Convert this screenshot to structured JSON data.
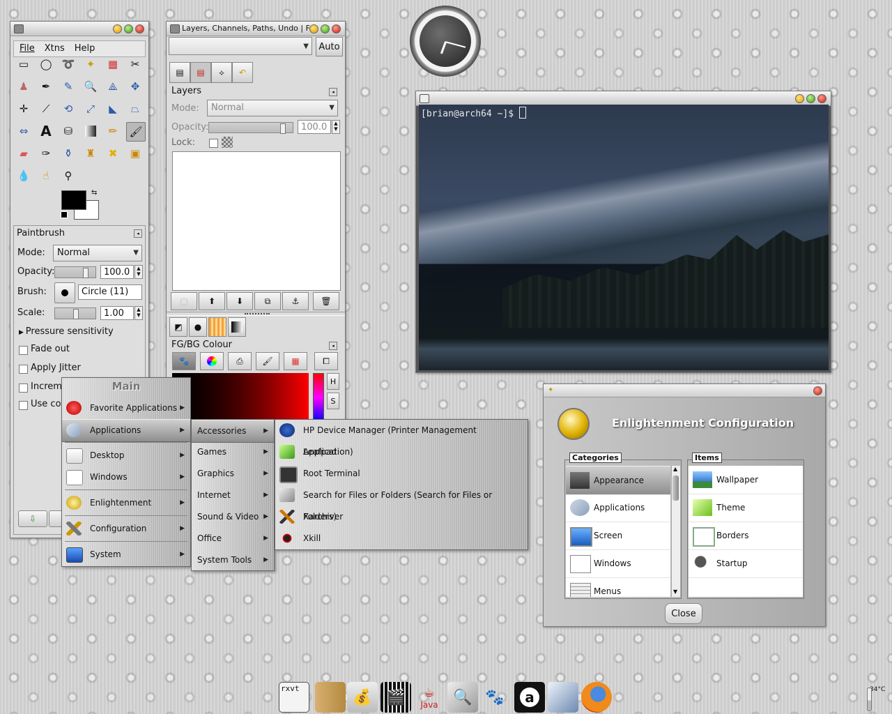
{
  "toolbox": {
    "menu": [
      "File",
      "Xtns",
      "Help"
    ],
    "panel_title": "Paintbrush",
    "mode_label": "Mode:",
    "mode_value": "Normal",
    "opacity_label": "Opacity:",
    "opacity_value": "100.0",
    "brush_label": "Brush:",
    "brush_value": "Circle (11)",
    "scale_label": "Scale:",
    "scale_value": "1.00",
    "pressure": "Pressure sensitivity",
    "fade_out": "Fade out",
    "apply_jitter": "Apply Jitter",
    "incremental": "Increme",
    "use_color": "Use co"
  },
  "layers_window": {
    "title": "Layers, Channels, Paths, Undo | F...",
    "auto_button": "Auto",
    "section_title": "Layers",
    "mode_label": "Mode:",
    "mode_value": "Normal",
    "opacity_label": "Opacity:",
    "opacity_value": "100.0",
    "lock_label": "Lock:",
    "fgbg_title": "FG/BG Colour",
    "hue_letter": "H",
    "sat_letter": "S"
  },
  "terminal": {
    "prompt": "[brian@arch64 ~]$ "
  },
  "main_menu": {
    "title": "Main",
    "items": [
      "Favorite Applications",
      "Applications",
      "Desktop",
      "Windows",
      "Enlightenment",
      "Configuration",
      "System"
    ]
  },
  "apps_menu": {
    "items": [
      "Accessories",
      "Games",
      "Graphics",
      "Internet",
      "Sound & Video",
      "Office",
      "System Tools"
    ]
  },
  "accessories_menu": {
    "items": [
      "HP Device Manager (Printer Management Application)",
      "Leafpad",
      "Root Terminal",
      "Search for Files or Folders (Search for Files or Folders)",
      "Xarchiver",
      "Xkill"
    ]
  },
  "config_dialog": {
    "title": "Enlightenment Configuration",
    "categories_label": "Categories",
    "items_label": "Items",
    "categories": [
      "Appearance",
      "Applications",
      "Screen",
      "Windows",
      "Menus"
    ],
    "items": [
      "Wallpaper",
      "Theme",
      "Borders",
      "Startup"
    ],
    "close_button": "Close"
  },
  "dock": {
    "rxvt_label": "rxvt",
    "java_label": "Java",
    "temperature": "34°C"
  },
  "colors": {
    "terminal_bg": "#2d3a4e",
    "menu_highlight": "#9a9a9a",
    "desktop": "#d2d2d2"
  }
}
